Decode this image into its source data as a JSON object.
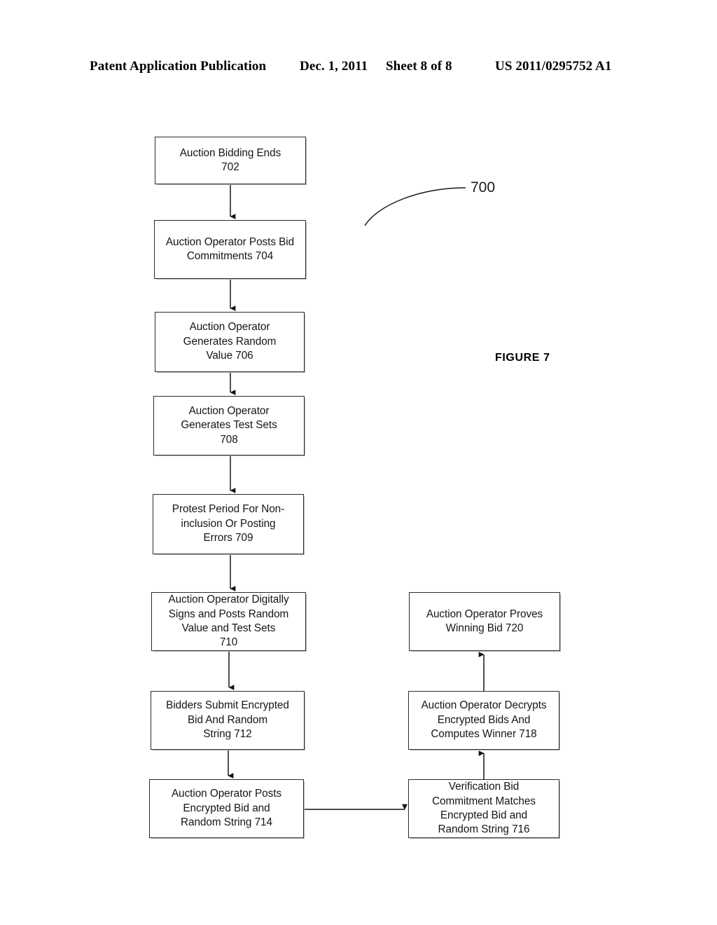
{
  "header": {
    "publication": "Patent Application Publication",
    "date": "Dec. 1, 2011",
    "sheet": "Sheet 8 of 8",
    "document_number": "US 2011/0295752 A1"
  },
  "figure": {
    "label": "FIGURE 7",
    "reference_numeral": "700"
  },
  "flowchart": {
    "boxes": [
      {
        "id": "702",
        "text": "Auction Bidding Ends\n702"
      },
      {
        "id": "704",
        "text": "Auction Operator Posts Bid\nCommitments         704"
      },
      {
        "id": "706",
        "text": "Auction Operator\nGenerates Random\nValue          706"
      },
      {
        "id": "708",
        "text": "Auction Operator\nGenerates Test Sets\n708"
      },
      {
        "id": "709",
        "text": "Protest Period For Non-\ninclusion Or Posting\nErrors          709"
      },
      {
        "id": "710",
        "text": "Auction Operator Digitally\nSigns and Posts Random\nValue and Test Sets\n710"
      },
      {
        "id": "712",
        "text": "Bidders Submit Encrypted\nBid And Random\nString          712"
      },
      {
        "id": "714",
        "text": "Auction Operator Posts\nEncrypted Bid and\nRandom String    714"
      },
      {
        "id": "716",
        "text": "Verification Bid\nCommitment Matches\nEncrypted Bid and\nRandom String      716"
      },
      {
        "id": "718",
        "text": "Auction Operator Decrypts\nEncrypted Bids And\nComputes Winner   718"
      },
      {
        "id": "720",
        "text": "Auction Operator Proves\nWinning Bid        720"
      }
    ],
    "connections": [
      {
        "from": "702",
        "to": "704",
        "direction": "down"
      },
      {
        "from": "704",
        "to": "706",
        "direction": "down"
      },
      {
        "from": "706",
        "to": "708",
        "direction": "down"
      },
      {
        "from": "708",
        "to": "709",
        "direction": "down"
      },
      {
        "from": "709",
        "to": "710",
        "direction": "down"
      },
      {
        "from": "710",
        "to": "712",
        "direction": "down"
      },
      {
        "from": "712",
        "to": "714",
        "direction": "down"
      },
      {
        "from": "714",
        "to": "716",
        "direction": "right"
      },
      {
        "from": "716",
        "to": "718",
        "direction": "up"
      },
      {
        "from": "718",
        "to": "720",
        "direction": "up"
      }
    ]
  },
  "colors": {
    "ink": "#151515",
    "box_border": "#2b2b2b",
    "page_background": "#ffffff"
  }
}
